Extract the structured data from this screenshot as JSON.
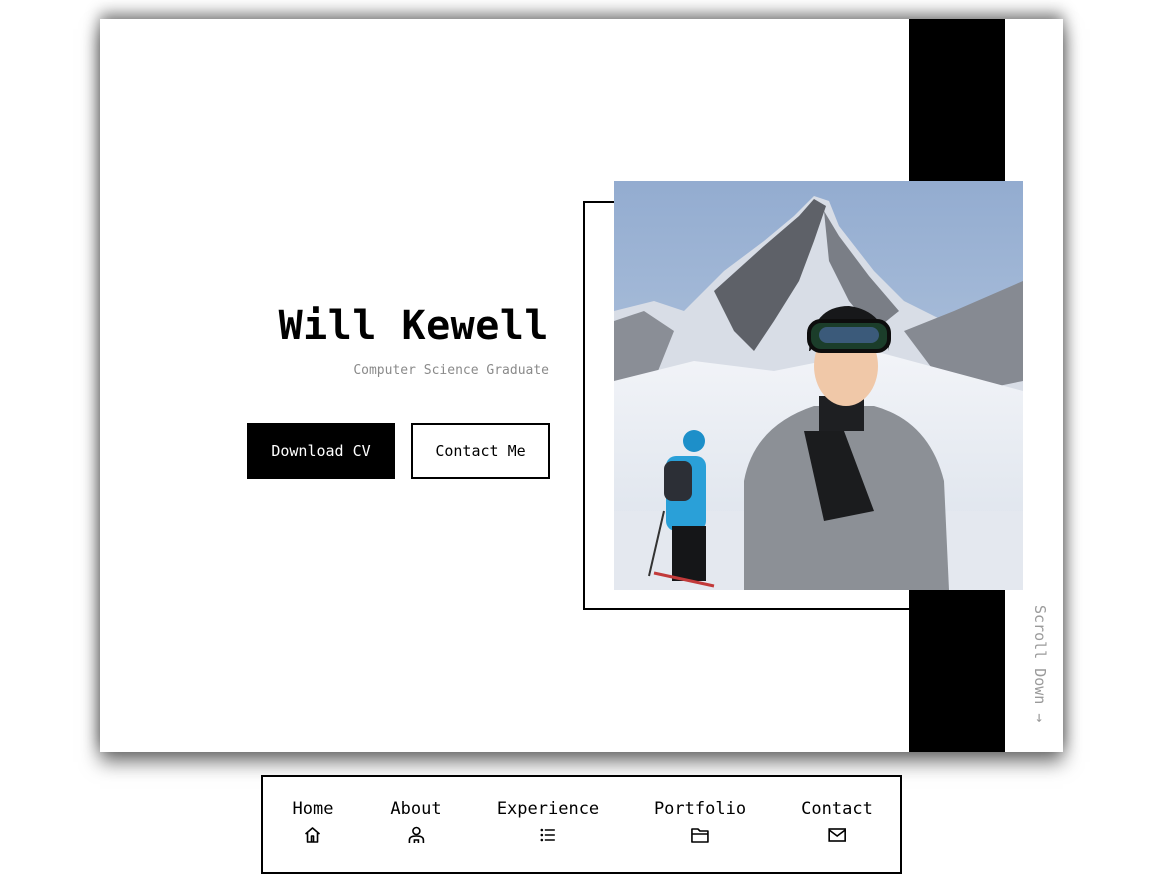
{
  "hero": {
    "name": "Will Kewell",
    "subtitle": "Computer Science Graduate",
    "download_cv_label": "Download CV",
    "contact_me_label": "Contact Me",
    "scroll_down_label": "Scroll Down →",
    "photo_alt": "Will Kewell skiing in front of a snowy mountain"
  },
  "nav": {
    "items": [
      {
        "label": "Home",
        "icon": "home-icon"
      },
      {
        "label": "About",
        "icon": "user-icon"
      },
      {
        "label": "Experience",
        "icon": "list-icon"
      },
      {
        "label": "Portfolio",
        "icon": "folder-icon"
      },
      {
        "label": "Contact",
        "icon": "mail-icon"
      }
    ]
  },
  "colors": {
    "primary": "#000000",
    "background": "#ffffff",
    "muted_text": "#8a8a8a"
  }
}
